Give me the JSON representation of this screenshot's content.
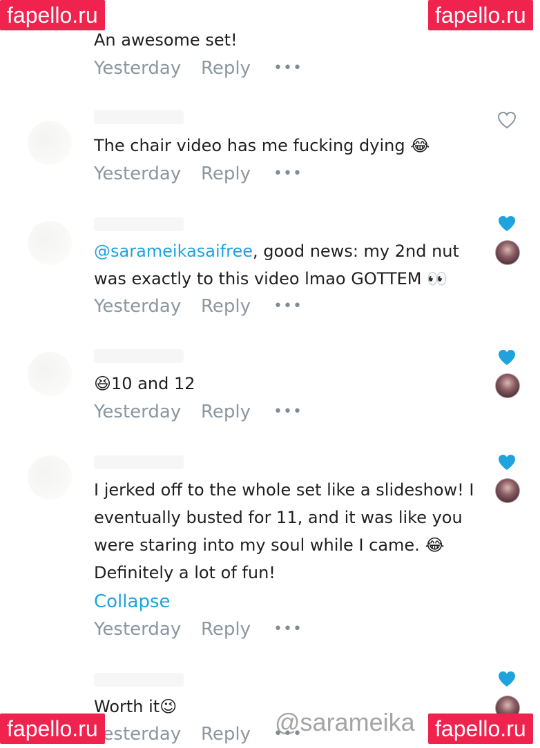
{
  "comments": [
    {
      "text": "An awesome set!",
      "time": "Yesterday",
      "reply": "Reply",
      "more": "•••",
      "liked": null
    },
    {
      "text": "The chair video has me fucking dying 😂",
      "time": "Yesterday",
      "reply": "Reply",
      "more": "•••",
      "liked": false
    },
    {
      "mention": "@sarameikasaifree",
      "text": ", good news: my 2nd nut was exactly to this video lmao GOTTEM 👀",
      "time": "Yesterday",
      "reply": "Reply",
      "more": "•••",
      "liked": true
    },
    {
      "text": "😆10 and 12",
      "time": "Yesterday",
      "reply": "Reply",
      "more": "•••",
      "liked": true
    },
    {
      "text": "I jerked off to the whole set like a slideshow! I eventually busted for 11, and it was like you were staring into my soul while I came. 😂 Definitely a lot of fun!",
      "collapse": "Collapse",
      "time": "Yesterday",
      "reply": "Reply",
      "more": "•••",
      "liked": true
    },
    {
      "text": "Worth it😉",
      "time": "Yesterday",
      "reply": "Reply",
      "more": "•••",
      "liked": true
    }
  ],
  "watermark": {
    "site": "fapello.ru",
    "handle": "@sarameika"
  },
  "colors": {
    "liked_heart": "#1fa3dd",
    "mention": "#1fa3dd",
    "watermark_bg": "#f0234f"
  }
}
